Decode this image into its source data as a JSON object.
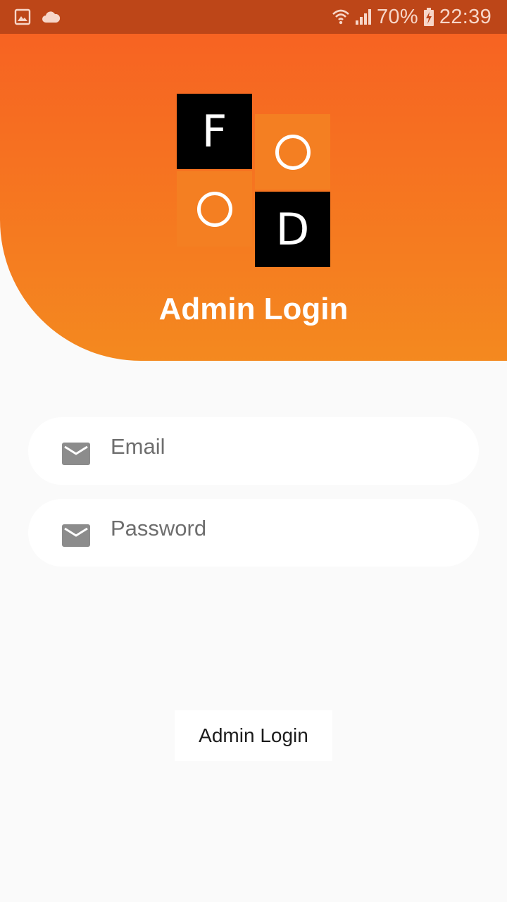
{
  "status_bar": {
    "battery": "70%",
    "time": "22:39",
    "icons": [
      "gallery-icon",
      "cloud-icon",
      "wifi-icon",
      "signal-icon",
      "battery-charging-icon"
    ]
  },
  "header": {
    "logo_letters": [
      "F",
      "O",
      "O",
      "D"
    ],
    "title": "Admin Login"
  },
  "form": {
    "email": {
      "placeholder": "Email",
      "value": "",
      "icon": "mail-icon"
    },
    "password": {
      "placeholder": "Password",
      "value": "",
      "icon": "mail-icon"
    }
  },
  "login_button": {
    "label": "Admin Login"
  },
  "colors": {
    "status_bar": "#bd4618",
    "header_top": "#f76322",
    "header_bottom": "#f4891f",
    "logo_dark": "#000000",
    "logo_orange": "#f47f22",
    "background": "#fafafa",
    "icon_gray": "#8c8c8c"
  }
}
